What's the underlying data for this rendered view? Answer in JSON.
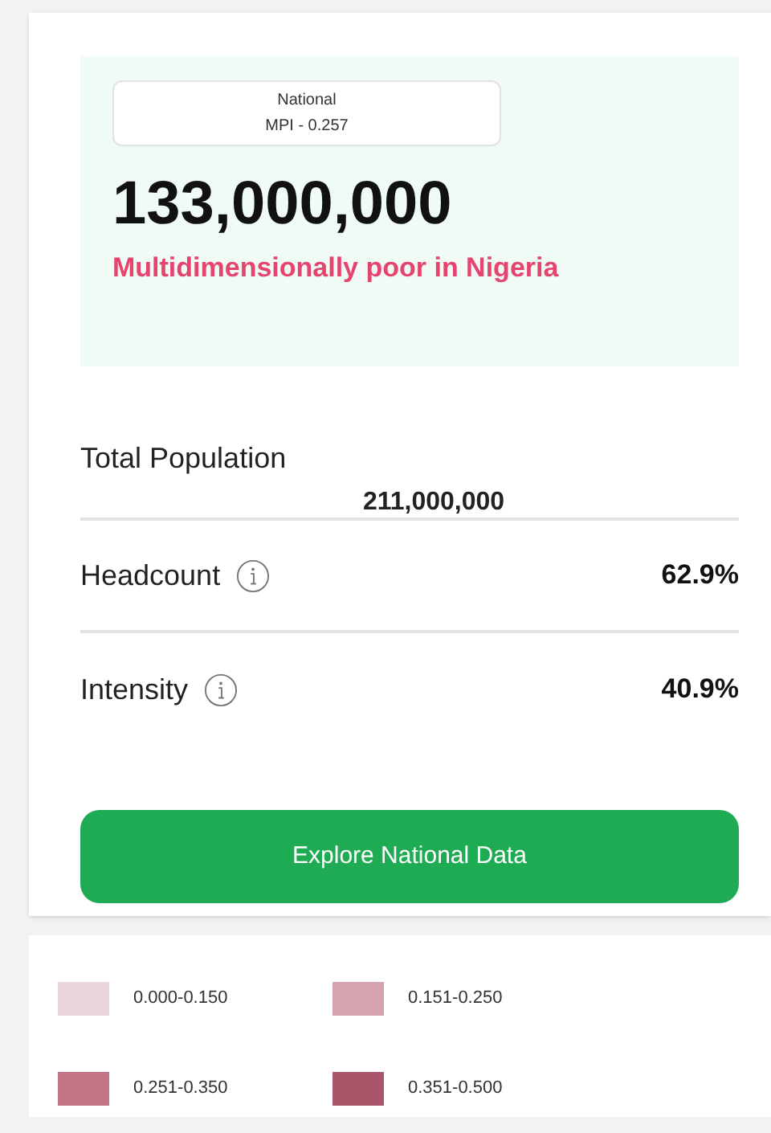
{
  "summary": {
    "tag": {
      "line_1": "National",
      "line_2": "MPI - 0.257"
    },
    "poor_count": "133,000,000",
    "poor_label": "Multidimensionally poor in Nigeria"
  },
  "stats": [
    {
      "label": "Total Population",
      "value": "211,000,000",
      "kind": "centered",
      "info": false
    },
    {
      "label": "Headcount",
      "value": "62.9%",
      "kind": "inline",
      "info": true
    },
    {
      "label": "Intensity",
      "value": "40.9%",
      "kind": "inline",
      "info": true
    }
  ],
  "button": "Explore National Data",
  "legend": [
    {
      "label": "0.000-0.150",
      "color": "#ecd6dd"
    },
    {
      "label": "0.151-0.250",
      "color": "#d5a2b0"
    },
    {
      "label": "0.251-0.350",
      "color": "#c17587"
    },
    {
      "label": "0.351-0.500",
      "color": "#a9566a"
    }
  ]
}
